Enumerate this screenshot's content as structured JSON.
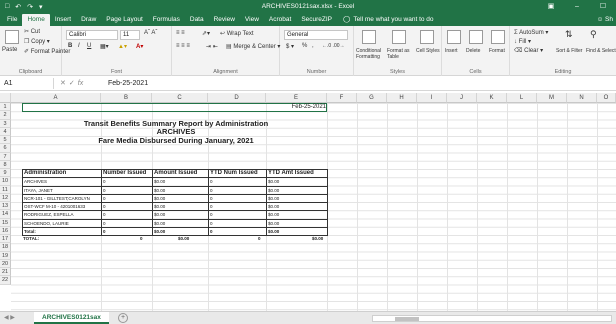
{
  "window": {
    "title": "ARCHIVES0121sax.xlsx - Excel",
    "qa_icons": [
      "save-icon",
      "undo-icon",
      "redo-icon"
    ],
    "controls": [
      "☐",
      "–",
      "☐",
      "✕"
    ],
    "accent_color": "#217346"
  },
  "menu": {
    "tabs": [
      "File",
      "Home",
      "Insert",
      "Draw",
      "Page Layout",
      "Formulas",
      "Data",
      "Review",
      "View",
      "Acrobat",
      "SecureZIP"
    ],
    "active": "Home",
    "tell_me": "Tell me what you want to do",
    "share": "Sh"
  },
  "ribbon": {
    "clipboard": {
      "label": "Clipboard",
      "paste": "Paste",
      "cut": "Cut",
      "copy": "Copy",
      "format_painter": "Format Painter"
    },
    "font": {
      "label": "Font",
      "name": "Calibri",
      "size": "11",
      "bold": "B",
      "italic": "I",
      "underline": "U"
    },
    "alignment": {
      "label": "Alignment",
      "wrap_text": "Wrap Text",
      "merge_center": "Merge & Center"
    },
    "number": {
      "label": "Number",
      "format": "General",
      "currency": "$",
      "percent": "%",
      "comma": ","
    },
    "styles": {
      "label": "Styles",
      "conditional": "Conditional Formatting",
      "format_as_table": "Format as Table",
      "cell_styles": "Cell Styles"
    },
    "cells": {
      "label": "Cells",
      "insert": "Insert",
      "delete": "Delete",
      "format": "Format"
    },
    "editing": {
      "label": "Editing",
      "autosum": "AutoSum",
      "fill": "Fill",
      "clear": "Clear",
      "sort_filter": "Sort & Filter",
      "find_select": "Find & Select"
    }
  },
  "formula_bar": {
    "name_box": "A1",
    "fx": "fx",
    "value": "Feb-25-2021"
  },
  "sheet": {
    "columns": [
      "A",
      "B",
      "C",
      "D",
      "E",
      "F",
      "G",
      "H",
      "I",
      "J",
      "K",
      "L",
      "M",
      "N",
      "O"
    ],
    "rows": [
      "1",
      "2",
      "3",
      "4",
      "5",
      "6",
      "7",
      "8",
      "9",
      "10",
      "11",
      "12",
      "13",
      "14",
      "15",
      "16",
      "17",
      "18",
      "19",
      "20",
      "21",
      "22"
    ],
    "date_cell": "Feb-25-2021",
    "report": {
      "title1": "Transit Benefits Summary Report by Administration",
      "title2": "ARCHIVES",
      "title3": "Fare Media Disbursed During January, 2021"
    },
    "table": {
      "headers": [
        "Administration",
        "Number Issued",
        "Amount Issued",
        "YTD Num Issued",
        "YTD Amt Issued"
      ],
      "rows": [
        [
          "ARCHIVES",
          "0",
          "$0.00",
          "0",
          "$0.00"
        ],
        [
          "ITAYA, JANET",
          "0",
          "$0.00",
          "0",
          "$0.00"
        ],
        [
          "NCR-101 - GILLTEST;CAROLYN",
          "0",
          "$0.00",
          "0",
          "$0.00"
        ],
        [
          "OST-WCF M-10 - 4201001633",
          "0",
          "$0.00",
          "0",
          "$0.00"
        ],
        [
          "RODRIGUEZ, ESPELLA",
          "0",
          "$0.00",
          "0",
          "$0.00"
        ],
        [
          "SCHOENDO, LAURIE",
          "0",
          "$0.00",
          "0",
          "$0.00"
        ]
      ],
      "total_row": [
        "Total:",
        "0",
        "$0.00",
        "0",
        "$0.00"
      ]
    },
    "grand_total": {
      "label": "TOTAL:",
      "num": "0",
      "amt": "$0.00",
      "ytd_num": "0",
      "ytd_amt": "$0.00"
    }
  },
  "tabs_bar": {
    "sheet_name": "ARCHIVES0121sax",
    "add": "+"
  }
}
